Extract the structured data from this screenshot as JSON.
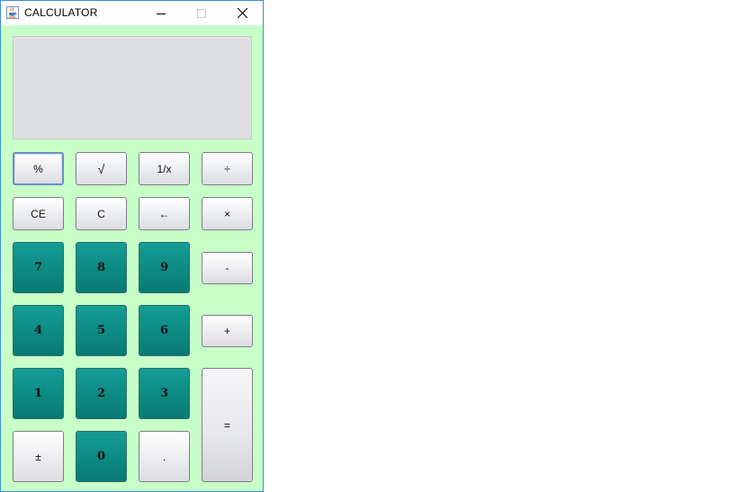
{
  "window": {
    "title": "CALCULATOR",
    "icon": "java-cup-icon",
    "controls": [
      "minimize-icon",
      "maximize-icon",
      "close-icon"
    ]
  },
  "display": {
    "value": ""
  },
  "colors": {
    "panel_background": "#c8ffc8",
    "digit_key": "#0f8c86",
    "operator_key": "#e8e9ec",
    "display_background": "#dddfe3",
    "window_border": "#3b8fd8"
  },
  "keys": {
    "percent": "%",
    "sqrt": "√",
    "reciprocal": "1/x",
    "divide": "÷",
    "ce": "CE",
    "c": "C",
    "backspace": "←",
    "multiply": "×",
    "seven": "7",
    "eight": "8",
    "nine": "9",
    "minus": "-",
    "four": "4",
    "five": "5",
    "six": "6",
    "plus": "+",
    "one": "1",
    "two": "2",
    "three": "3",
    "equals": "=",
    "plus_minus": "±",
    "zero": "0",
    "decimal": "."
  }
}
